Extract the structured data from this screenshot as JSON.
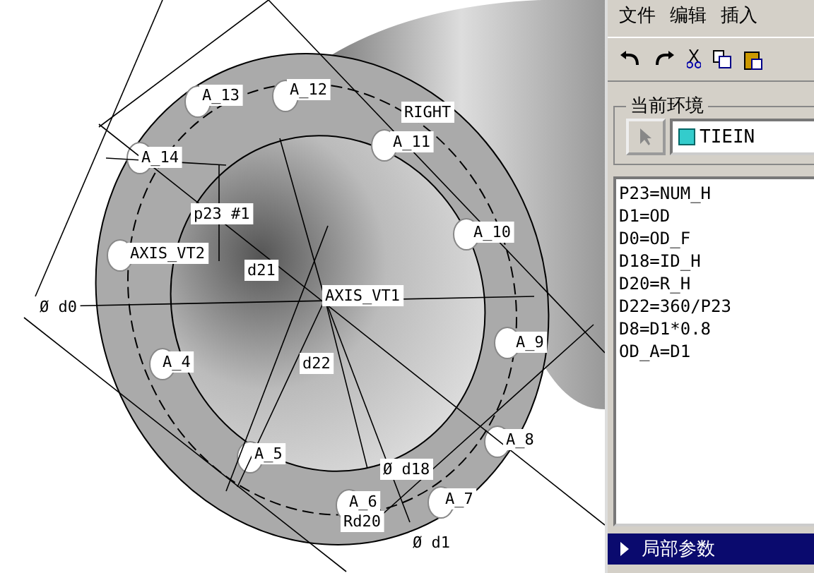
{
  "viewport": {
    "labels": [
      "A_13",
      "A_12",
      "RIGHT",
      "A_11",
      "A_14",
      "p23 #1",
      "AXIS_VT2",
      "d21",
      "AXIS_VT1",
      "A_10",
      "Ø d0",
      "A_9",
      "A_4",
      "d22",
      "A_8",
      "A_5",
      "Ø d18",
      "A_6",
      "A_7",
      "Rd20",
      "Ø d1"
    ]
  },
  "menu": [
    "文件",
    "编辑",
    "插入"
  ],
  "environment": {
    "title": "当前环境",
    "value": "TIEIN"
  },
  "relations": [
    "P23=NUM_H",
    "D1=OD",
    "D0=OD_F",
    "D18=ID_H",
    "D20=R_H",
    "D22=360/P23",
    "D8=D1*0.8",
    "OD_A=D1"
  ],
  "footer": {
    "label": "局部参数",
    "expanded": false
  }
}
